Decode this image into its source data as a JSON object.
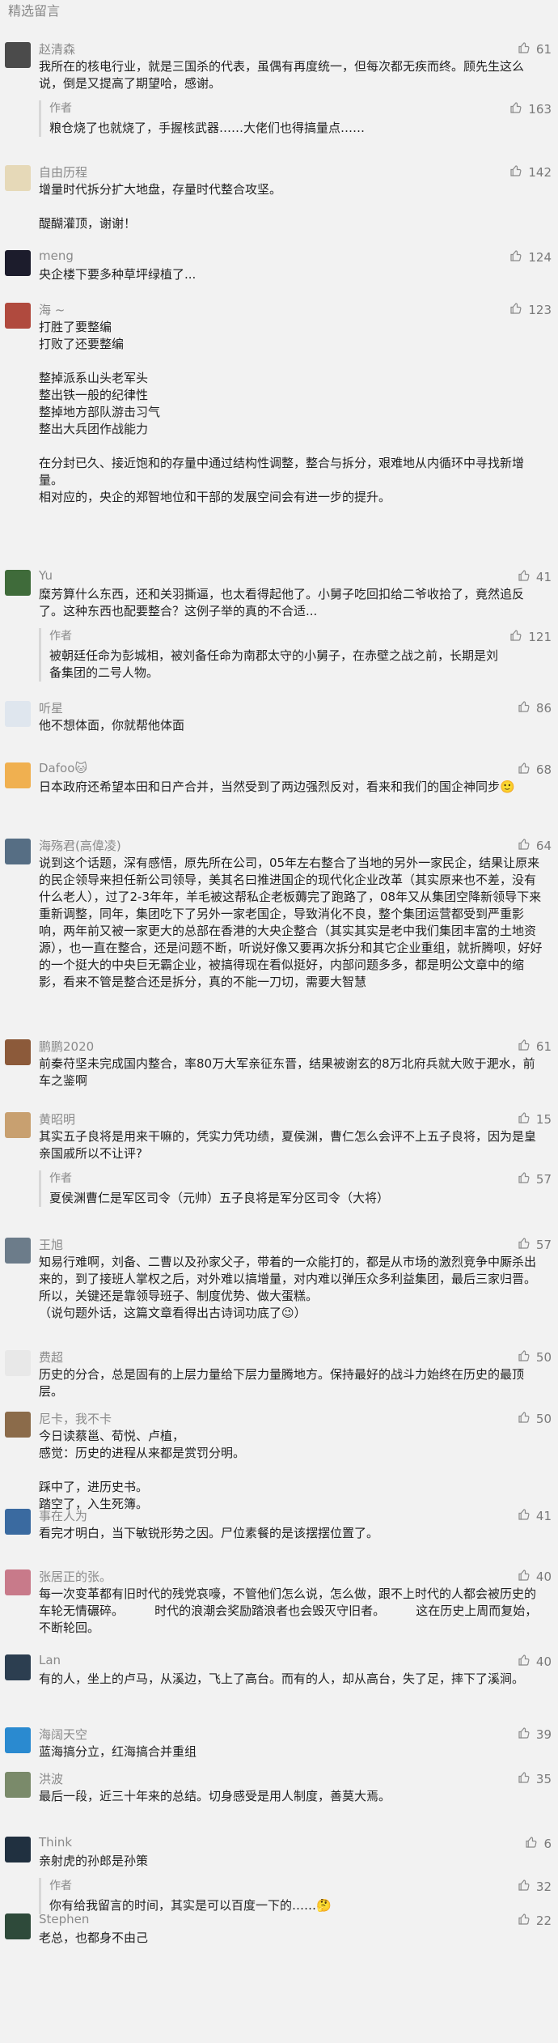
{
  "section_title": "精选留言",
  "comments": [
    {
      "name": "赵清森",
      "likes": "61",
      "text": "我所在的核电行业，就是三国杀的代表，虽偶有再度统一，但每次都无疾而终。顾先生这么说，倒是又提高了期望哈，感谢。",
      "reply": {
        "label": "作者",
        "likes": "163",
        "text": "粮仓烧了也就烧了，手握核武器……大佬们也得搞量点……"
      }
    },
    {
      "name": "自由历程",
      "likes": "142",
      "text": "增量时代拆分扩大地盘，存量时代整合攻坚。\n\n醍醐灌顶，谢谢！"
    },
    {
      "name": "meng",
      "likes": "124",
      "text": "央企楼下要多种草坪绿植了..."
    },
    {
      "name": "海 ~",
      "likes": "123",
      "text": "打胜了要整编\n打败了还要整编\n\n整掉派系山头老军头\n整出铁一般的纪律性\n整掉地方部队游击习气\n整出大兵团作战能力\n\n在分封已久、接近饱和的存量中通过结构性调整，整合与拆分，艰难地从内循环中寻找新增量。\n相对应的，央企的郑智地位和干部的发展空间会有进一步的提升。"
    },
    {
      "name": "Yu",
      "likes": "41",
      "text": "糜芳算什么东西，还和关羽撕逼，也太看得起他了。小舅子吃回扣给二爷收拾了，竟然追反了。这种东西也配要整合？这例子举的真的不合适...",
      "reply": {
        "label": "作者",
        "likes": "121",
        "text": "被朝廷任命为彭城相，被刘备任命为南郡太守的小舅子，在赤壁之战之前，长期是刘备集团的二号人物。"
      }
    },
    {
      "name": "听星",
      "likes": "86",
      "text": "他不想体面，你就帮他体面"
    },
    {
      "name": "Dafoo🐱",
      "likes": "68",
      "text": "日本政府还希望本田和日产合并，当然受到了两边强烈反对，看来和我们的国企神同步🙂"
    },
    {
      "name": "海殇君(高偉凌)",
      "likes": "64",
      "text": "说到这个话题，深有感悟，原先所在公司，05年左右整合了当地的另外一家民企，结果让原来的民企领导来担任新公司领导，美其名曰推进国企的现代化企业改革（其实原来也不差，没有什么老人），过了2-3年年，羊毛被这帮私企老板薅完了跑路了，08年又从集团空降新领导下来重新调整，同年，集团吃下了另外一家老国企，导致消化不良，整个集团运营都受到严重影响，两年前又被一家更大的总部在香港的大央企整合（其实其实是老中我们集团丰富的土地资源），也一直在整合，还是问题不断，听说好像又要再次拆分和其它企业重组，就折腾呗，好好的一个挺大的中央巨无霸企业，被搞得现在看似挺好，内部问题多多，都是明公文章中的缩影，看来不管是整合还是拆分，真的不能一刀切，需要大智慧"
    },
    {
      "name": "鹏鹏2020",
      "likes": "61",
      "text": "前秦苻坚未完成国内整合，率80万大军亲征东晋，结果被谢玄的8万北府兵就大败于淝水，前车之鉴啊"
    },
    {
      "name": "黄昭明",
      "likes": "15",
      "text": "其实五子良将是用来干嘛的，凭实力凭功绩，夏侯渊，曹仁怎么会评不上五子良将，因为是皇亲国戚所以不让评?",
      "reply": {
        "label": "作者",
        "likes": "57",
        "text": "夏侯渊曹仁是军区司令（元帅）五子良将是军分区司令（大将）"
      }
    },
    {
      "name": "王旭",
      "likes": "57",
      "text": "知易行难啊，刘备、二曹以及孙家父子，带着的一众能打的，都是从市场的激烈竞争中厮杀出来的，到了接班人掌权之后，对外难以搞增量，对内难以弹压众多利益集团，最后三家归晋。所以，关键还是靠领导班子、制度优势、做大蛋糕。\n（说句题外话，这篇文章看得出古诗词功底了😉）"
    },
    {
      "name": "费超",
      "likes": "50",
      "text": "历史的分合，总是固有的上层力量给下层力量腾地方。保持最好的战斗力始终在历史的最顶层。"
    },
    {
      "name": "尼卡，我不卡",
      "likes": "50",
      "text": "今日读蔡邕、荀悦、卢植，\n感觉：历史的进程从来都是赏罚分明。\n\n踩中了，进历史书。\n踏空了，入生死簿。"
    },
    {
      "name": "事在人为",
      "likes": "41",
      "text": "看完才明白，当下敏锐形势之因。尸位素餐的是该摆摆位置了。"
    },
    {
      "name": "张居正的张。",
      "likes": "40",
      "text": "每一次变革都有旧时代的残党哀嚎，不管他们怎么说，怎么做，跟不上时代的人都会被历史的车轮无情碾碎。        时代的浪潮会奖励踏浪者也会毁灭守旧者。        这在历史上周而复始，不断轮回。"
    },
    {
      "name": "Lan",
      "likes": "40",
      "text": "有的人，坐上的卢马，从溪边，飞上了高台。而有的人，却从高台，失了足，摔下了溪涧。"
    },
    {
      "name": "海阔天空",
      "likes": "39",
      "text": "蓝海搞分立，红海搞合并重组"
    },
    {
      "name": "洪波",
      "likes": "35",
      "text": "最后一段，近三十年来的总结。切身感受是用人制度，善莫大焉。"
    },
    {
      "name": "Think",
      "likes": "6",
      "text": "亲射虎的孙郎是孙策",
      "reply": {
        "label": "作者",
        "likes": "32",
        "text": "你有给我留言的时间，其实是可以百度一下的……🤔"
      }
    },
    {
      "name": "Stephen",
      "likes": "22",
      "text": "老总，也都身不由己"
    }
  ]
}
